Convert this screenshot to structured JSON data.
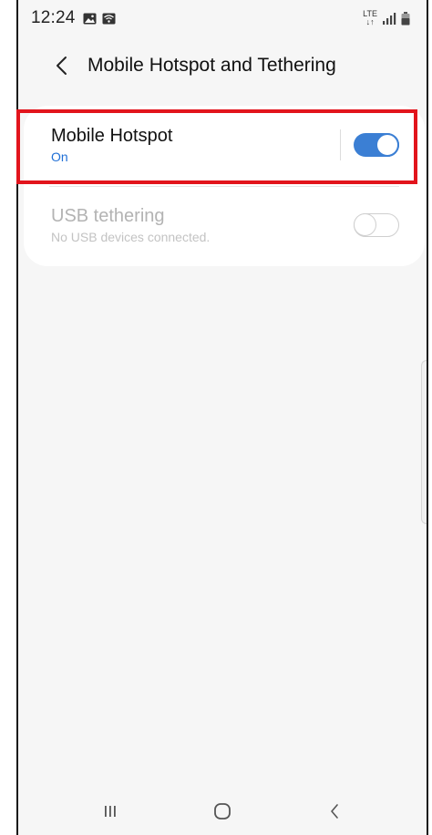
{
  "status_bar": {
    "time": "12:24",
    "network_label_top": "LTE",
    "network_label_bottom": "↓↑"
  },
  "header": {
    "title": "Mobile Hotspot and Tethering"
  },
  "settings": {
    "mobile_hotspot": {
      "title": "Mobile Hotspot",
      "status": "On",
      "enabled": true
    },
    "usb_tethering": {
      "title": "USB tethering",
      "status": "No USB devices connected.",
      "enabled": false
    }
  },
  "colors": {
    "accent": "#3b7fd4",
    "highlight": "#e2141c",
    "status_on": "#1f6fd6"
  },
  "icons": {
    "status_left": [
      "gallery-icon",
      "wifi-icon"
    ],
    "status_right": [
      "signal-icon",
      "battery-icon"
    ],
    "header": "back-arrow-icon",
    "nav": [
      "recent-apps-icon",
      "home-icon",
      "back-icon"
    ]
  }
}
